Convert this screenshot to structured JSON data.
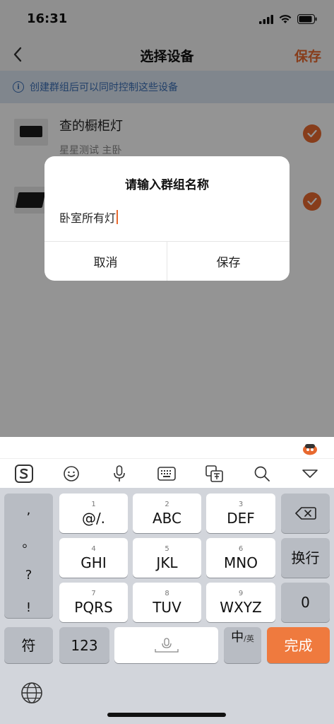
{
  "status_bar": {
    "time": "16:31"
  },
  "nav": {
    "title": "选择设备",
    "save_label": "保存"
  },
  "banner": {
    "icon_char": "i",
    "text": "创建群组后可以同时控制这些设备"
  },
  "devices": [
    {
      "name": "查的橱柜灯",
      "sub": "星星测试 主卧",
      "checked": true
    },
    {
      "name": "",
      "sub": "",
      "checked": true
    }
  ],
  "dialog": {
    "title": "请输入群组名称",
    "input_value": "卧室所有灯",
    "cancel_label": "取消",
    "save_label": "保存"
  },
  "keyboard": {
    "punct": [
      ",",
      "。",
      "?",
      "!"
    ],
    "keys": [
      {
        "num": "1",
        "label": "@/."
      },
      {
        "num": "2",
        "label": "ABC"
      },
      {
        "num": "3",
        "label": "DEF"
      },
      {
        "num": "4",
        "label": "GHI"
      },
      {
        "num": "5",
        "label": "JKL"
      },
      {
        "num": "6",
        "label": "MNO"
      },
      {
        "num": "7",
        "label": "PQRS"
      },
      {
        "num": "8",
        "label": "TUV"
      },
      {
        "num": "9",
        "label": "WXYZ"
      }
    ],
    "newline_label": "换行",
    "zero_label": "0",
    "symbol_label": "符",
    "num_label": "123",
    "lang_main": "中",
    "lang_sub": "/英",
    "done_label": "完成"
  },
  "colors": {
    "accent": "#e8692f",
    "banner_text": "#3b6fb6",
    "banner_bg": "#dde7f3",
    "done_key": "#ef7a3e"
  }
}
